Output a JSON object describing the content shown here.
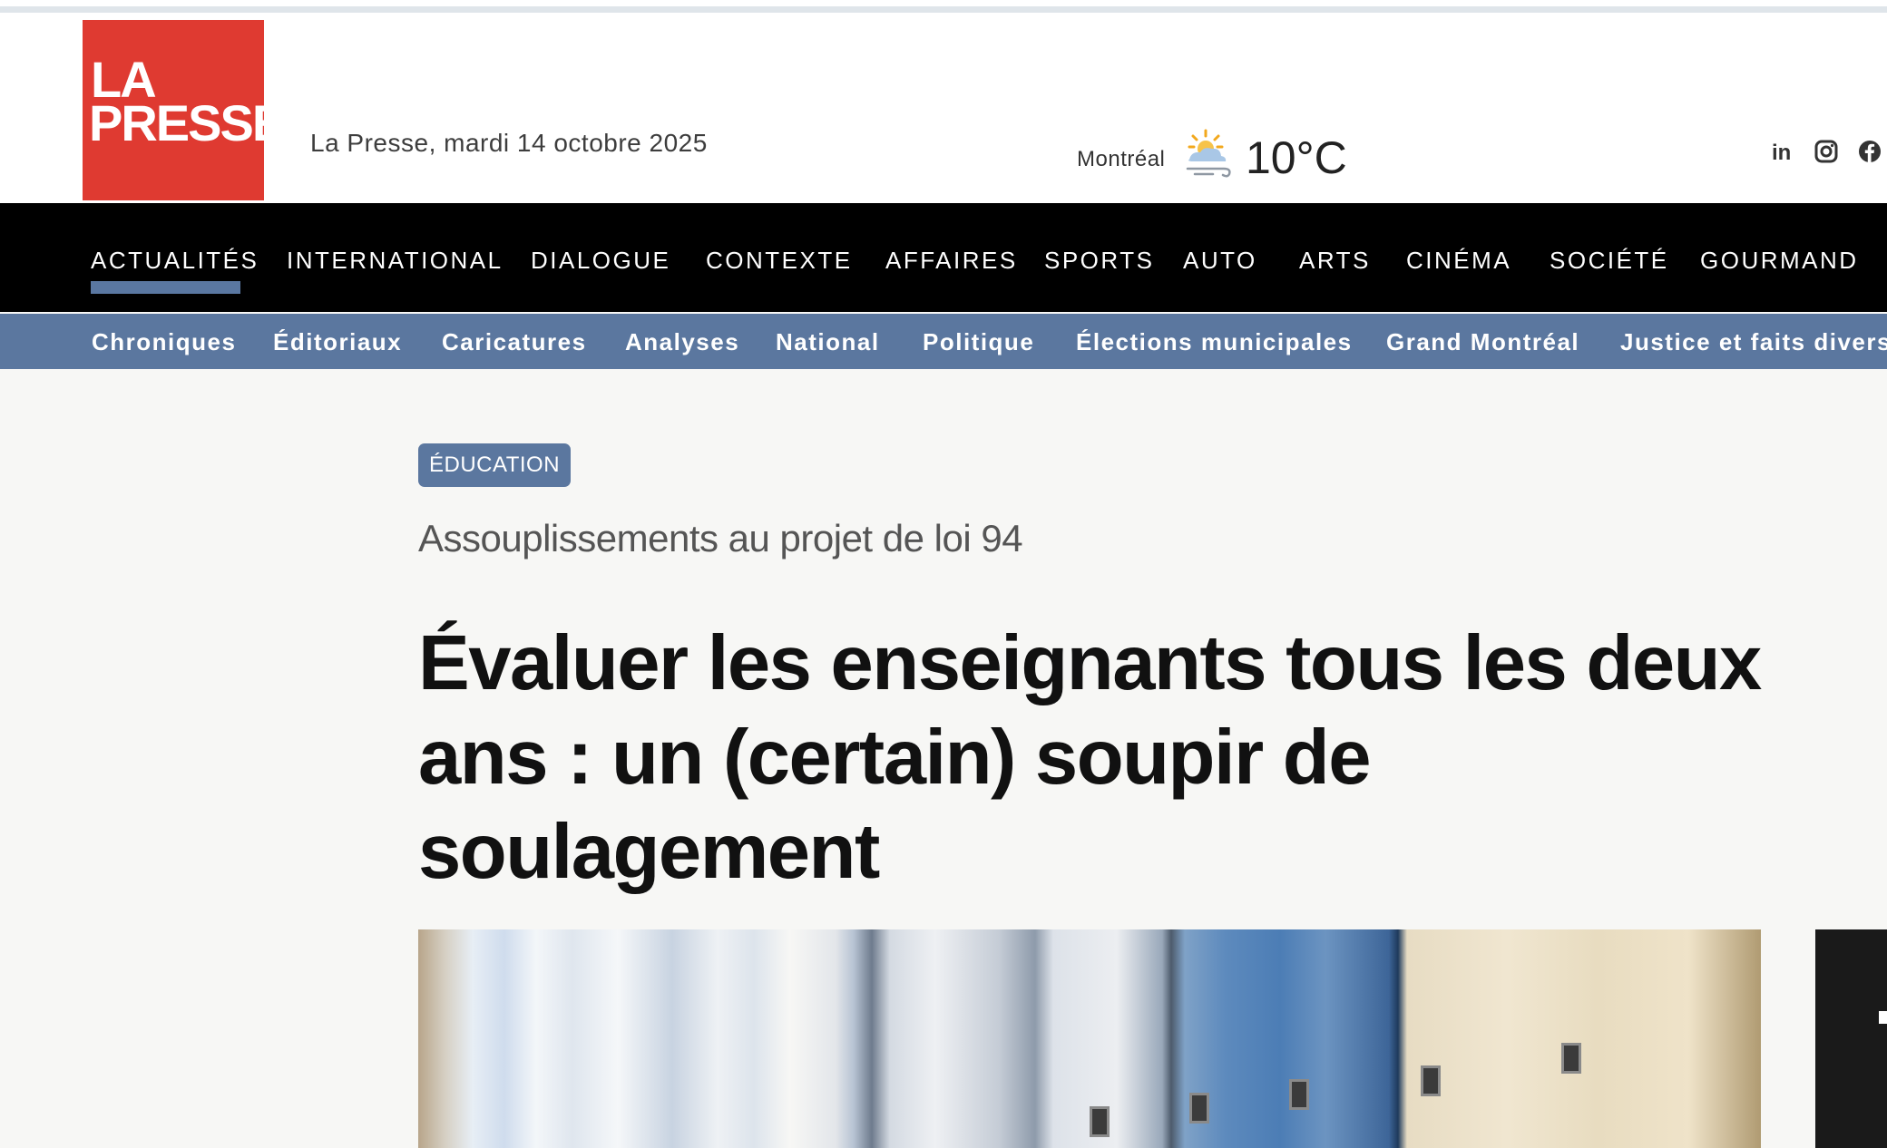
{
  "header": {
    "logo_line1": "LA",
    "logo_line2": "PRESSE",
    "date": "La Presse, mardi 14 octobre 2025",
    "weather": {
      "city": "Montréal",
      "temperature": "10°C",
      "icon": "partly-sunny-windy-icon"
    },
    "social": [
      "linkedin-icon",
      "instagram-icon",
      "facebook-icon"
    ]
  },
  "main_nav": {
    "active": "ACTUALITÉS",
    "items": [
      "ACTUALITÉS",
      "INTERNATIONAL",
      "DIALOGUE",
      "CONTEXTE",
      "AFFAIRES",
      "SPORTS",
      "AUTO",
      "ARTS",
      "CINÉMA",
      "SOCIÉTÉ",
      "GOURMAND"
    ]
  },
  "sub_nav": {
    "items": [
      "Chroniques",
      "Éditoriaux",
      "Caricatures",
      "Analyses",
      "National",
      "Politique",
      "Élections municipales",
      "Grand Montréal",
      "Justice et faits divers"
    ]
  },
  "article": {
    "tag": "ÉDUCATION",
    "kicker": "Assouplissements au projet de loi 94",
    "headline": "Évaluer les enseignants tous les deux ans : un (certain) soupir de soulagement"
  },
  "colors": {
    "brand_red": "#df3a31",
    "nav_black": "#000000",
    "sub_nav_blue": "#5b779f",
    "active_underline": "#5a77a1"
  }
}
